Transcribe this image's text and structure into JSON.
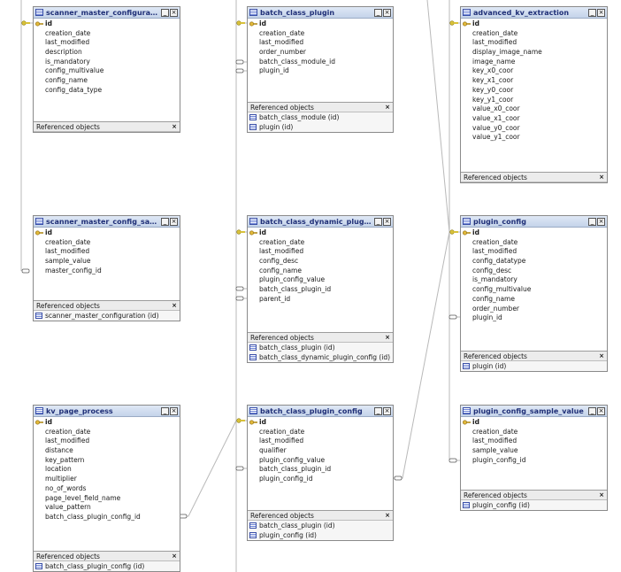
{
  "ui": {
    "minimize_glyph": "_",
    "close_glyph": "×",
    "ref_header": "Referenced objects",
    "ref_close": "×"
  },
  "tables": [
    {
      "id": "t1",
      "title": "scanner_master_configuration",
      "columns": [
        {
          "name": "id",
          "pk": true
        },
        {
          "name": "creation_date"
        },
        {
          "name": "last_modified"
        },
        {
          "name": "description"
        },
        {
          "name": "is_mandatory"
        },
        {
          "name": "config_multivalue"
        },
        {
          "name": "config_name"
        },
        {
          "name": "config_data_type"
        }
      ],
      "refs": []
    },
    {
      "id": "t2",
      "title": "batch_class_plugin",
      "columns": [
        {
          "name": "id",
          "pk": true
        },
        {
          "name": "creation_date"
        },
        {
          "name": "last_modified"
        },
        {
          "name": "order_number"
        },
        {
          "name": "batch_class_module_id"
        },
        {
          "name": "plugin_id"
        }
      ],
      "refs": [
        "batch_class_module (id)",
        "plugin (id)"
      ]
    },
    {
      "id": "t3",
      "title": "advanced_kv_extraction",
      "columns": [
        {
          "name": "id",
          "pk": true
        },
        {
          "name": "creation_date"
        },
        {
          "name": "last_modified"
        },
        {
          "name": "display_image_name"
        },
        {
          "name": "image_name"
        },
        {
          "name": "key_x0_coor"
        },
        {
          "name": "key_x1_coor"
        },
        {
          "name": "key_y0_coor"
        },
        {
          "name": "key_y1_coor"
        },
        {
          "name": "value_x0_coor"
        },
        {
          "name": "value_x1_coor"
        },
        {
          "name": "value_y0_coor"
        },
        {
          "name": "value_y1_coor"
        }
      ],
      "refs": []
    },
    {
      "id": "t4",
      "title": "scanner_master_config_sampl...",
      "columns": [
        {
          "name": "id",
          "pk": true
        },
        {
          "name": "creation_date"
        },
        {
          "name": "last_modified"
        },
        {
          "name": "sample_value"
        },
        {
          "name": "master_config_id"
        }
      ],
      "refs": [
        "scanner_master_configuration (id)"
      ]
    },
    {
      "id": "t5",
      "title": "batch_class_dynamic_plugin_c...",
      "columns": [
        {
          "name": "id",
          "pk": true
        },
        {
          "name": "creation_date"
        },
        {
          "name": "last_modified"
        },
        {
          "name": "config_desc"
        },
        {
          "name": "config_name"
        },
        {
          "name": "plugin_config_value"
        },
        {
          "name": "batch_class_plugin_id"
        },
        {
          "name": "parent_id"
        }
      ],
      "refs": [
        "batch_class_plugin (id)",
        "batch_class_dynamic_plugin_config (id)"
      ]
    },
    {
      "id": "t6",
      "title": "plugin_config",
      "columns": [
        {
          "name": "id",
          "pk": true
        },
        {
          "name": "creation_date"
        },
        {
          "name": "last_modified"
        },
        {
          "name": "config_datatype"
        },
        {
          "name": "config_desc"
        },
        {
          "name": "is_mandatory"
        },
        {
          "name": "config_multivalue"
        },
        {
          "name": "config_name"
        },
        {
          "name": "order_number"
        },
        {
          "name": "plugin_id"
        }
      ],
      "refs": [
        "plugin (id)"
      ]
    },
    {
      "id": "t7",
      "title": "kv_page_process",
      "columns": [
        {
          "name": "id",
          "pk": true
        },
        {
          "name": "creation_date"
        },
        {
          "name": "last_modified"
        },
        {
          "name": "distance"
        },
        {
          "name": "key_pattern"
        },
        {
          "name": "location"
        },
        {
          "name": "multiplier"
        },
        {
          "name": "no_of_words"
        },
        {
          "name": "page_level_field_name"
        },
        {
          "name": "value_pattern"
        },
        {
          "name": "batch_class_plugin_config_id"
        }
      ],
      "refs": [
        "batch_class_plugin_config (id)"
      ]
    },
    {
      "id": "t8",
      "title": "batch_class_plugin_config",
      "columns": [
        {
          "name": "id",
          "pk": true
        },
        {
          "name": "creation_date"
        },
        {
          "name": "last_modified"
        },
        {
          "name": "qualifier"
        },
        {
          "name": "plugin_config_value"
        },
        {
          "name": "batch_class_plugin_id"
        },
        {
          "name": "plugin_config_id"
        }
      ],
      "refs": [
        "batch_class_plugin (id)",
        "plugin_config (id)"
      ]
    },
    {
      "id": "t9",
      "title": "plugin_config_sample_value",
      "columns": [
        {
          "name": "id",
          "pk": true
        },
        {
          "name": "creation_date"
        },
        {
          "name": "last_modified"
        },
        {
          "name": "sample_value"
        },
        {
          "name": "plugin_config_id"
        }
      ],
      "refs": [
        "plugin_config (id)"
      ]
    }
  ]
}
